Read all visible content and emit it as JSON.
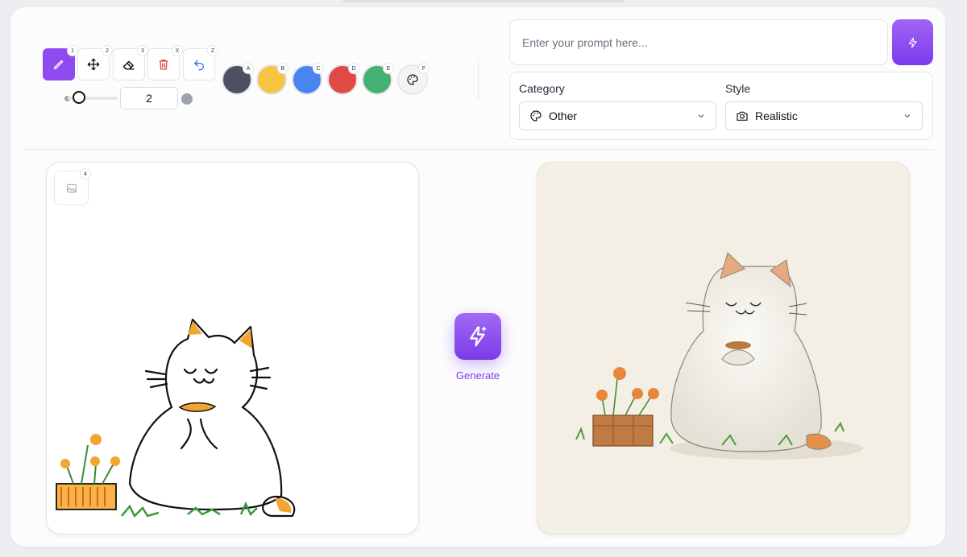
{
  "toolbar": {
    "tools": [
      {
        "name": "brush",
        "badge": "1"
      },
      {
        "name": "move",
        "badge": "2"
      },
      {
        "name": "eraser",
        "badge": "3"
      },
      {
        "name": "clear",
        "badge": "X"
      },
      {
        "name": "undo",
        "badge": "Z"
      }
    ],
    "active_tool": "brush",
    "brush_size": "2",
    "colors": [
      {
        "hex": "#4b5160",
        "badge": "A"
      },
      {
        "hex": "#f5c443",
        "badge": "B"
      },
      {
        "hex": "#4a84ef",
        "badge": "C"
      },
      {
        "hex": "#e04a45",
        "badge": "D"
      },
      {
        "hex": "#44b074",
        "badge": "E"
      }
    ],
    "custom_color_badge": "F"
  },
  "prompt": {
    "placeholder": "Enter your prompt here..."
  },
  "options": {
    "category_label": "Category",
    "category_value": "Other",
    "style_label": "Style",
    "style_value": "Realistic"
  },
  "canvas": {
    "upload_badge": "4"
  },
  "generate": {
    "label": "Generate"
  },
  "accent_color": "#8d4bf0"
}
